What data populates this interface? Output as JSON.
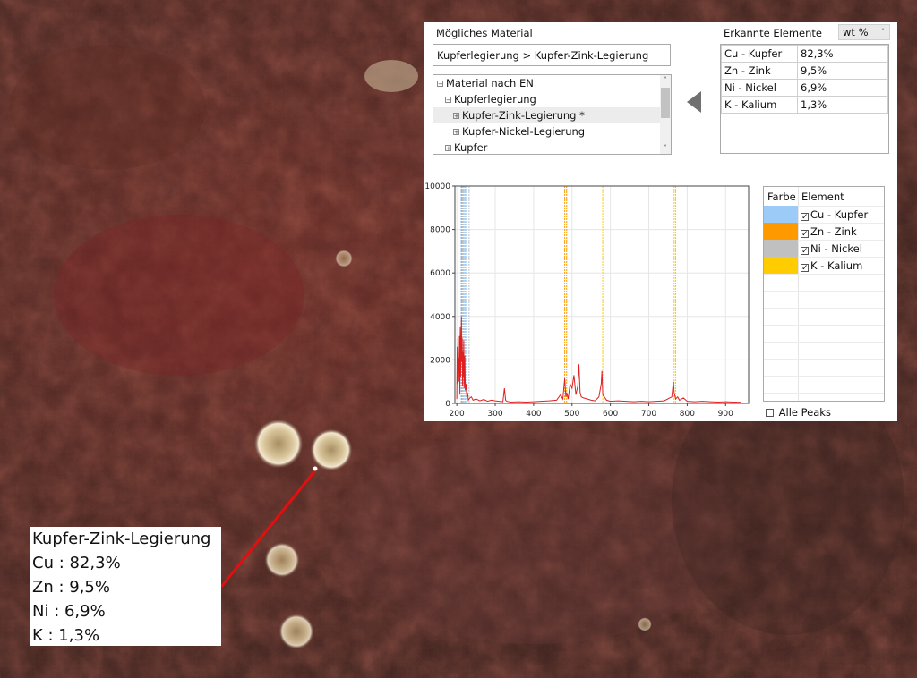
{
  "colors": {
    "cu": "#9ccbf7",
    "zn": "#ff9900",
    "ni": "#c0c0c0",
    "k": "#ffcc00",
    "spectrum": "#e02020",
    "arrow": "#e01010"
  },
  "material_panel": {
    "title": "Mögliches Material",
    "path_value": "Kupferlegierung > Kupfer-Zink-Legierung",
    "tree": [
      {
        "label": "Material nach EN",
        "level": 0,
        "toggle": "minus"
      },
      {
        "label": "Kupferlegierung",
        "level": 1,
        "toggle": "minus"
      },
      {
        "label": "Kupfer-Zink-Legierung *",
        "level": 2,
        "toggle": "plus",
        "selected": true
      },
      {
        "label": "Kupfer-Nickel-Legierung",
        "level": 2,
        "toggle": "plus"
      },
      {
        "label": "Kupfer",
        "level": 1,
        "toggle": "plus"
      }
    ]
  },
  "elements_panel": {
    "title": "Erkannte Elemente",
    "unit_selector": "wt %",
    "rows": [
      {
        "element": "Cu - Kupfer",
        "value": "82,3%"
      },
      {
        "element": "Zn - Zink",
        "value": "9,5%"
      },
      {
        "element": "Ni - Nickel",
        "value": "6,9%"
      },
      {
        "element": "K - Kalium",
        "value": "1,3%"
      }
    ]
  },
  "legend": {
    "col_color": "Farbe",
    "col_element": "Element",
    "items": [
      {
        "label": "Cu - Kupfer",
        "color_key": "cu",
        "checked": true
      },
      {
        "label": "Zn - Zink",
        "color_key": "zn",
        "checked": true
      },
      {
        "label": "Ni - Nickel",
        "color_key": "ni",
        "checked": true
      },
      {
        "label": "K - Kalium",
        "color_key": "k",
        "checked": true
      }
    ],
    "all_peaks_label": "Alle Peaks",
    "all_peaks_checked": false
  },
  "chart_data": {
    "type": "line",
    "title": "",
    "xlabel": "",
    "ylabel": "",
    "xlim": [
      195,
      960
    ],
    "ylim": [
      0,
      10000
    ],
    "x_ticks": [
      200,
      300,
      400,
      500,
      600,
      700,
      800,
      900
    ],
    "y_ticks": [
      0,
      2000,
      4000,
      6000,
      8000,
      10000
    ],
    "grid": true,
    "element_lines": [
      {
        "element": "Cu",
        "x": [
          211,
          217,
          219,
          222,
          225
        ]
      },
      {
        "element": "Zn",
        "x": [
          213,
          481,
          486
        ]
      },
      {
        "element": "Ni",
        "x": [
          215,
          232
        ]
      },
      {
        "element": "K",
        "x": [
          580,
          766,
          770
        ]
      }
    ],
    "series": [
      {
        "values_note": "",
        "x": [
          200,
          201,
          202,
          203,
          204,
          205,
          206,
          207,
          208,
          209,
          210,
          211,
          212,
          213,
          214,
          215,
          216,
          217,
          218,
          219,
          220,
          221,
          222,
          224,
          226,
          228,
          230,
          234,
          238,
          242,
          250,
          260,
          270,
          280,
          290,
          300,
          310,
          320,
          324,
          327,
          330,
          340,
          360,
          380,
          400,
          420,
          440,
          460,
          470,
          476,
          481,
          484,
          486,
          490,
          495,
          500,
          505,
          510,
          515,
          518,
          521,
          524,
          530,
          540,
          550,
          560,
          570,
          576,
          578,
          580,
          584,
          590,
          600,
          620,
          640,
          660,
          680,
          700,
          720,
          740,
          760,
          764,
          766,
          768,
          770,
          775,
          780,
          790,
          800,
          820,
          840,
          860,
          880,
          900,
          920,
          940
        ],
        "y": [
          200,
          2600,
          900,
          3000,
          1500,
          2100,
          1000,
          3100,
          400,
          3500,
          1200,
          2500,
          4000,
          1900,
          3000,
          800,
          2400,
          1200,
          2900,
          700,
          1300,
          2200,
          600,
          900,
          300,
          500,
          150,
          250,
          300,
          150,
          200,
          120,
          180,
          100,
          150,
          120,
          100,
          80,
          700,
          150,
          100,
          60,
          80,
          60,
          80,
          100,
          120,
          150,
          400,
          200,
          1150,
          300,
          500,
          200,
          900,
          700,
          1300,
          400,
          800,
          1800,
          500,
          300,
          250,
          200,
          150,
          120,
          300,
          900,
          1500,
          400,
          300,
          150,
          100,
          120,
          100,
          80,
          100,
          80,
          100,
          120,
          300,
          1000,
          500,
          350,
          200,
          300,
          150,
          250,
          100,
          80,
          100,
          80,
          60,
          80,
          60,
          50
        ]
      }
    ]
  },
  "annotation": {
    "title": "Kupfer-Zink-Legierung",
    "lines": [
      "Cu : 82,3%",
      "Zn : 9,5%",
      "Ni : 6,9%",
      "K : 1,3%"
    ]
  }
}
